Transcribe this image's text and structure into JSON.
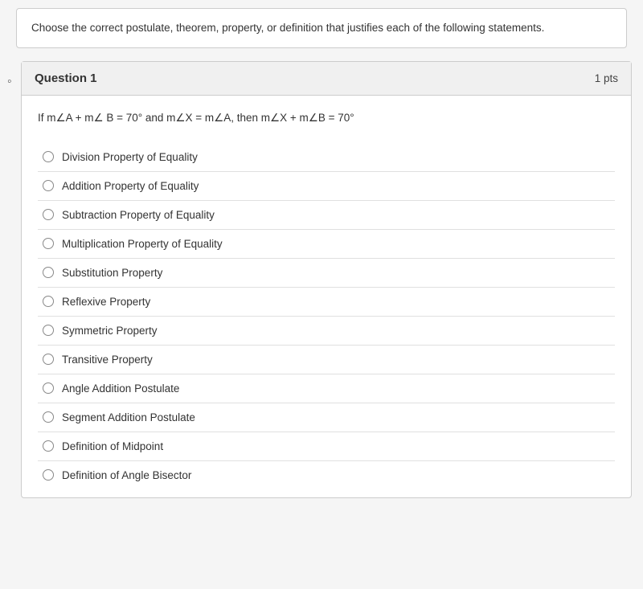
{
  "instructions": {
    "text": "Choose the correct postulate, theorem, property, or definition that justifies each of the following statements."
  },
  "question": {
    "number": "Question 1",
    "points": "1 pts",
    "statement": "If m∠A + m∠ B = 70° and m∠X = m∠A, then m∠X + m∠B = 70°",
    "options": [
      {
        "label": "Division Property of Equality"
      },
      {
        "label": "Addition Property of Equality"
      },
      {
        "label": "Subtraction Property of Equality"
      },
      {
        "label": "Multiplication Property of Equality"
      },
      {
        "label": "Substitution Property"
      },
      {
        "label": "Reflexive Property"
      },
      {
        "label": "Symmetric Property"
      },
      {
        "label": "Transitive Property"
      },
      {
        "label": "Angle Addition Postulate"
      },
      {
        "label": "Segment Addition Postulate"
      },
      {
        "label": "Definition of Midpoint"
      },
      {
        "label": "Definition of Angle Bisector"
      }
    ]
  }
}
